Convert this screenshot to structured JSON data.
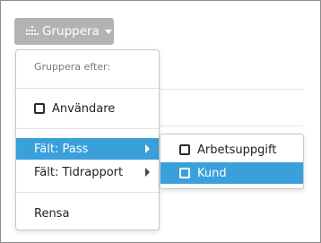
{
  "toolbar": {
    "group_button_label": "Gruppera",
    "group_button_icon": "bar-chart-icon"
  },
  "group_menu": {
    "header": "Gruppera efter:",
    "items": [
      {
        "label": "Användare",
        "icon": "checkbox-icon",
        "checked": false
      },
      {
        "label": "Fält: Pass",
        "icon": "chevron-right-icon",
        "active": true
      },
      {
        "label": "Fält: Tidrapport",
        "icon": "chevron-right-icon",
        "active": false
      },
      {
        "label": "Rensa"
      }
    ]
  },
  "submenu": {
    "items": [
      {
        "label": "Arbetsuppgift",
        "icon": "checkbox-icon",
        "checked": false,
        "active": false
      },
      {
        "label": "Kund",
        "icon": "checkbox-icon",
        "checked": false,
        "active": true
      }
    ]
  },
  "colors": {
    "button_bg": "#b3b3b3",
    "highlight": "#3aa0db",
    "frame_border": "#8c8c8c"
  }
}
